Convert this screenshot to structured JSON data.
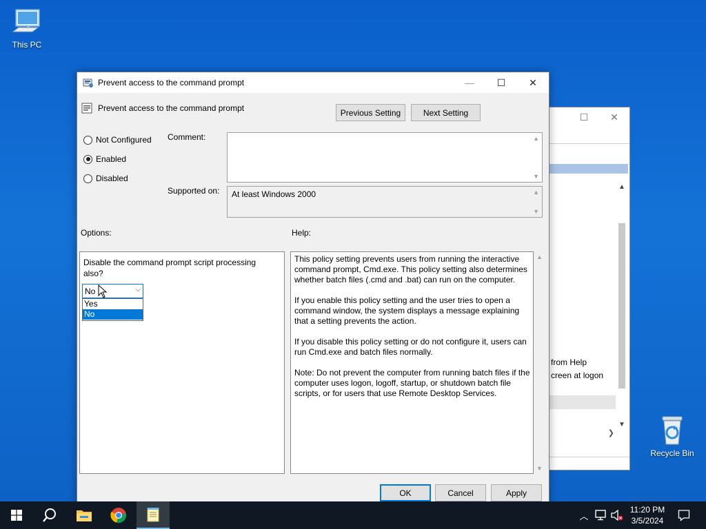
{
  "desktop": {
    "icons": [
      {
        "label": "This PC"
      },
      {
        "label": "Recycle Bin"
      }
    ]
  },
  "background_window": {
    "list_text": [
      "from Help",
      "creen at logon"
    ]
  },
  "dialog": {
    "title": "Prevent access to the command prompt",
    "policy_name": "Prevent access to the command prompt",
    "previous_label": "Previous Setting",
    "next_label": "Next Setting",
    "radio_options": [
      {
        "label": "Not Configured",
        "selected": false
      },
      {
        "label": "Enabled",
        "selected": true
      },
      {
        "label": "Disabled",
        "selected": false
      }
    ],
    "comment_label": "Comment:",
    "comment_value": "",
    "supported_label": "Supported on:",
    "supported_value": "At least Windows 2000",
    "options_label": "Options:",
    "help_label": "Help:",
    "option_text": "Disable the command prompt script processing also?",
    "combo_value": "No",
    "combo_options": [
      "Yes",
      "No"
    ],
    "help_paragraphs": [
      "This policy setting prevents users from running the interactive command prompt, Cmd.exe.  This policy setting also determines whether batch files (.cmd and .bat) can run on the computer.",
      "If you enable this policy setting and the user tries to open a command window, the system displays a message explaining that a setting prevents the action.",
      "If you disable this policy setting or do not configure it, users can run Cmd.exe and batch files normally.",
      "Note: Do not prevent the computer from running batch files if the computer uses logon, logoff, startup, or shutdown batch file scripts, or for users that use Remote Desktop Services."
    ],
    "ok_label": "OK",
    "cancel_label": "Cancel",
    "apply_label": "Apply"
  },
  "taskbar": {
    "pinned": [
      "start-icon",
      "search-icon",
      "file-explorer-icon",
      "chrome-icon",
      "notepad-icon"
    ],
    "tray_icons": [
      "chevron-up-icon",
      "network-icon",
      "volume-muted-icon"
    ],
    "time": "11:20 PM",
    "date": "3/5/2024"
  },
  "colors": {
    "accent": "#0078d7",
    "desktop": "#0b5fcb",
    "taskbar": "#101923"
  }
}
